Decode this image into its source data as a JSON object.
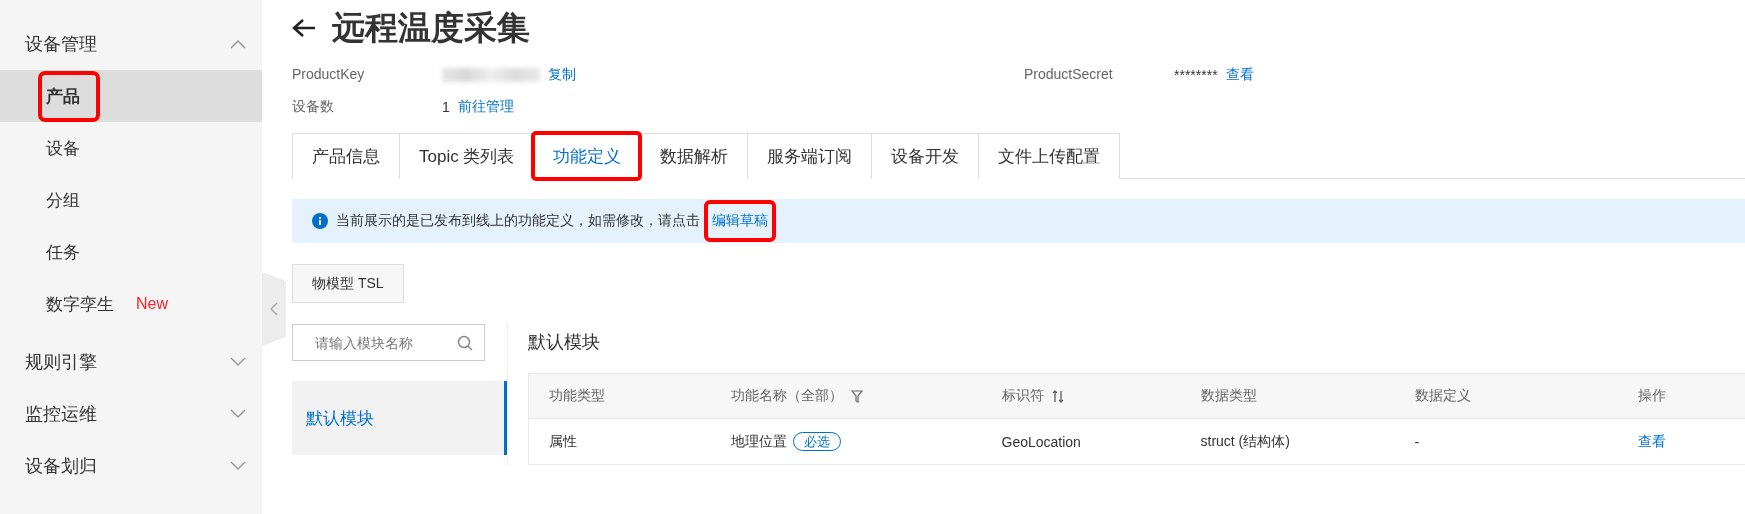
{
  "sidebar": {
    "items": [
      {
        "label": "设备管理",
        "expanded": true,
        "children": [
          {
            "label": "产品",
            "selected": true,
            "highlighted": true
          },
          {
            "label": "设备",
            "selected": false,
            "highlighted": false
          },
          {
            "label": "分组",
            "selected": false,
            "highlighted": false
          },
          {
            "label": "任务",
            "selected": false,
            "highlighted": false
          },
          {
            "label": "数字孪生",
            "badge": "New",
            "selected": false,
            "highlighted": false
          }
        ]
      },
      {
        "label": "规则引擎",
        "expanded": false
      },
      {
        "label": "监控运维",
        "expanded": false
      },
      {
        "label": "设备划归",
        "expanded": false
      }
    ]
  },
  "header": {
    "title": "远程温度采集"
  },
  "info": {
    "product_key_label": "ProductKey",
    "copy_link": "复制",
    "product_secret_label": "ProductSecret",
    "product_secret_value": "********",
    "view_link": "查看",
    "device_count_label": "设备数",
    "device_count_value": "1",
    "manage_link": "前往管理"
  },
  "tabs": [
    {
      "label": "产品信息",
      "selected": false,
      "highlighted": false
    },
    {
      "label": "Topic 类列表",
      "selected": false,
      "highlighted": false
    },
    {
      "label": "功能定义",
      "selected": true,
      "highlighted": true
    },
    {
      "label": "数据解析",
      "selected": false,
      "highlighted": false
    },
    {
      "label": "服务端订阅",
      "selected": false,
      "highlighted": false
    },
    {
      "label": "设备开发",
      "selected": false,
      "highlighted": false
    },
    {
      "label": "文件上传配置",
      "selected": false,
      "highlighted": false
    }
  ],
  "notice": {
    "text": "当前展示的是已发布到线上的功能定义，如需修改，请点击",
    "link": "编辑草稿",
    "link_highlighted": true
  },
  "tsl_button": "物模型 TSL",
  "module_search": {
    "placeholder": "请输入模块名称"
  },
  "modules": [
    {
      "label": "默认模块",
      "selected": true
    }
  ],
  "section_title": "默认模块",
  "table": {
    "columns": [
      {
        "label": "功能类型",
        "kind": "plain"
      },
      {
        "label": "功能名称（全部）",
        "kind": "filter"
      },
      {
        "label": "标识符",
        "kind": "sort"
      },
      {
        "label": "数据类型",
        "kind": "plain"
      },
      {
        "label": "数据定义",
        "kind": "plain"
      },
      {
        "label": "操作",
        "kind": "plain"
      }
    ],
    "rows": [
      {
        "type": "属性",
        "name": "地理位置",
        "tag": "必选",
        "identifier": "GeoLocation",
        "data_type": "struct (结构体)",
        "definition": "-",
        "action": "查看"
      }
    ]
  }
}
